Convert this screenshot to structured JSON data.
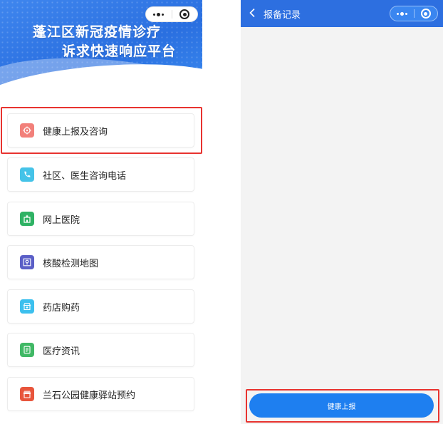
{
  "left_screen": {
    "banner": {
      "title_line1": "蓬江区新冠疫情诊疗",
      "title_line2": "诉求快速响应平台"
    },
    "menu_items": [
      {
        "label": "健康上报及咨询",
        "icon": "health-report-icon",
        "icon_color": "#f2807a"
      },
      {
        "label": "社区、医生咨询电话",
        "icon": "phone-icon",
        "icon_color": "#45c3e8"
      },
      {
        "label": "网上医院",
        "icon": "hospital-icon",
        "icon_color": "#2fb264"
      },
      {
        "label": "核酸检测地图",
        "icon": "map-icon",
        "icon_color": "#5b5fc7"
      },
      {
        "label": "药店购药",
        "icon": "pharmacy-icon",
        "icon_color": "#3cc0ee"
      },
      {
        "label": "医疗资讯",
        "icon": "news-icon",
        "icon_color": "#40b865"
      },
      {
        "label": "兰石公园健康驿站预约",
        "icon": "station-icon",
        "icon_color": "#e8553c"
      }
    ]
  },
  "right_screen": {
    "nav": {
      "title": "报备记录"
    },
    "report_button_label": "健康上报"
  },
  "colors": {
    "brand_blue": "#2d6fe0",
    "button_blue": "#1e7ff0",
    "highlight_red": "#e8332f"
  }
}
